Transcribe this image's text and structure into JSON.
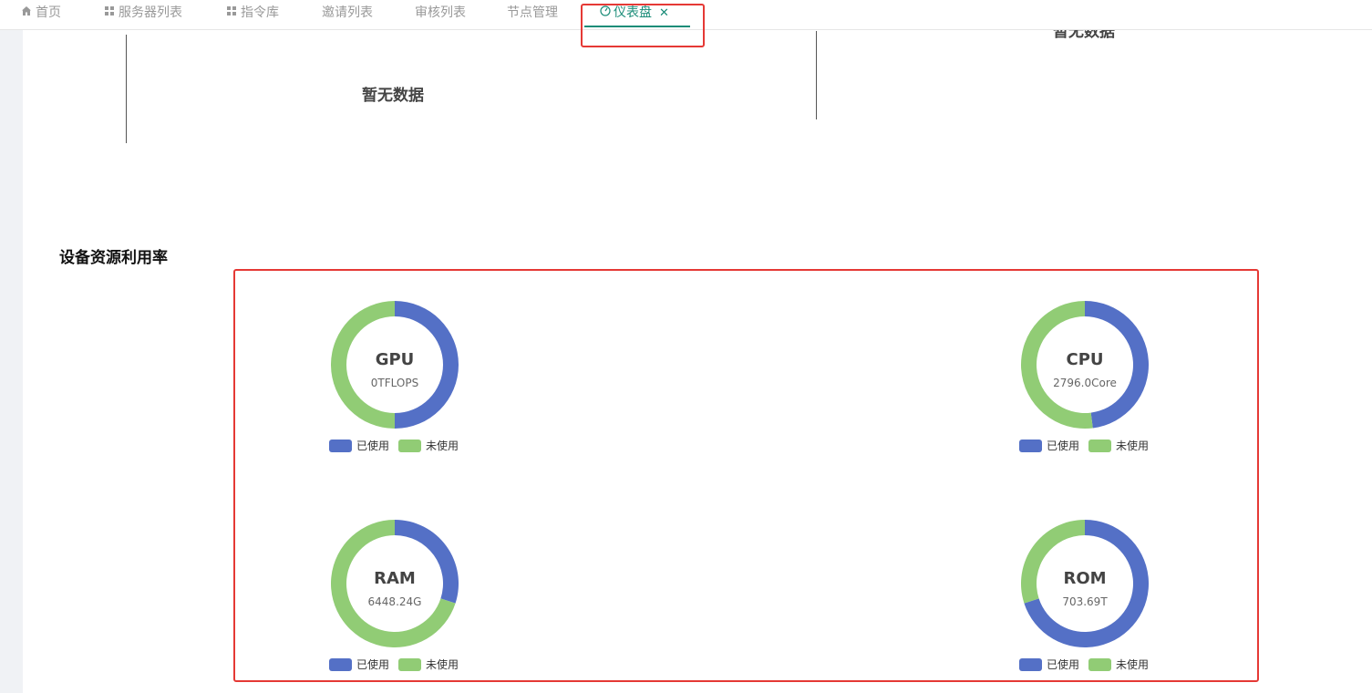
{
  "tabs": [
    {
      "label": "首页",
      "icon": "home-icon"
    },
    {
      "label": "服务器列表",
      "icon": "grid-icon"
    },
    {
      "label": "指令库",
      "icon": "grid-icon"
    },
    {
      "label": "邀请列表",
      "icon": ""
    },
    {
      "label": "审核列表",
      "icon": ""
    },
    {
      "label": "节点管理",
      "icon": ""
    },
    {
      "label": "仪表盘",
      "icon": "dashboard-icon",
      "active": true,
      "closable": true
    }
  ],
  "panels": {
    "left_empty": "暂无数据",
    "right_empty": "暂无数据"
  },
  "section": {
    "title": "设备资源利用率"
  },
  "colors": {
    "used": "#5470c6",
    "unused": "#91cc75",
    "accent": "#1a8c78",
    "highlight": "#e53935"
  },
  "legend": {
    "used": "已使用",
    "unused": "未使用"
  },
  "gauges": [
    {
      "name": "GPU",
      "value": "0TFLOPS",
      "used_fraction": 0.5
    },
    {
      "name": "CPU",
      "value": "2796.0Core",
      "used_fraction": 0.48
    },
    {
      "name": "RAM",
      "value": "6448.24G",
      "used_fraction": 0.3
    },
    {
      "name": "ROM",
      "value": "703.69T",
      "used_fraction": 0.7
    }
  ]
}
